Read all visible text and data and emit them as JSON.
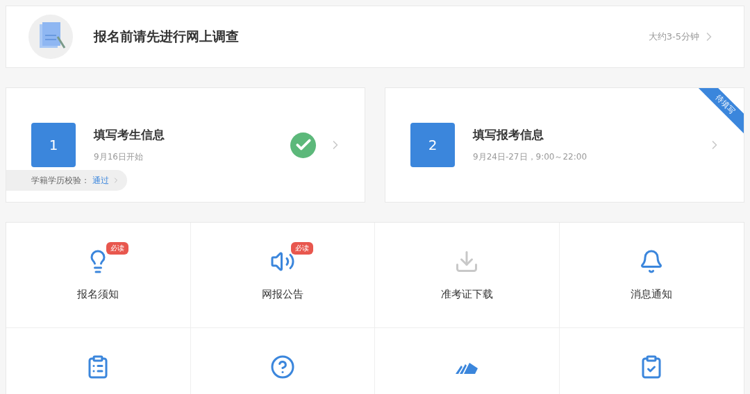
{
  "survey": {
    "title": "报名前请先进行网上调查",
    "hint": "大约3-5分钟"
  },
  "steps": [
    {
      "number": "1",
      "title": "填写考生信息",
      "date": "9月16日开始",
      "done": true,
      "verify": {
        "label": "学籍学历校验：",
        "value": "通过"
      }
    },
    {
      "number": "2",
      "title": "填写报考信息",
      "date": "9月24日-27日，9:00～22:00",
      "done": false,
      "ribbon": "待填写"
    }
  ],
  "tiles": [
    {
      "kind": "bulb",
      "label": "报名须知",
      "badge": "必读",
      "disabled": false
    },
    {
      "kind": "speaker",
      "label": "网报公告",
      "badge": "必读",
      "disabled": false
    },
    {
      "kind": "download",
      "label": "准考证下载",
      "disabled": true
    },
    {
      "kind": "bell",
      "label": "消息通知",
      "disabled": false
    },
    {
      "kind": "clipboard",
      "disabled": false
    },
    {
      "kind": "help",
      "disabled": false
    },
    {
      "kind": "tickets",
      "disabled": false
    },
    {
      "kind": "clipboard-check",
      "disabled": false
    }
  ]
}
